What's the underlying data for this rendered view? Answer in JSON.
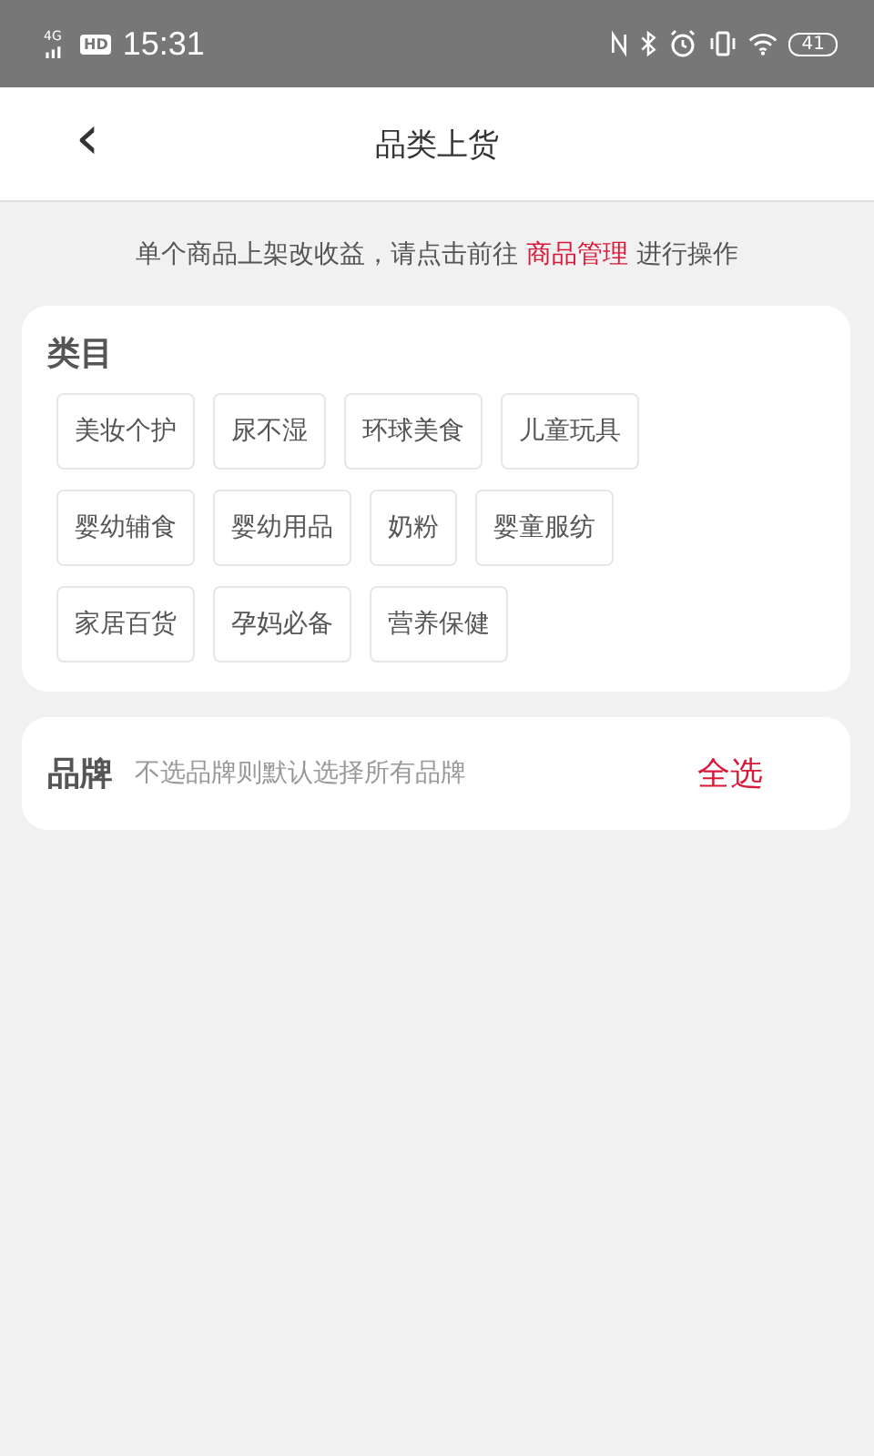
{
  "status_bar": {
    "network": "4G",
    "hd": "HD",
    "time": "15:31",
    "battery": "41"
  },
  "header": {
    "back": "‹",
    "title": "品类上货"
  },
  "notice": {
    "before": "单个商品上架改收益，请点击前往 ",
    "link": "商品管理",
    "after": " 进行操作"
  },
  "category": {
    "title": "类目",
    "chips": [
      "美妆个护",
      "尿不湿",
      "环球美食",
      "儿童玩具",
      "婴幼辅食",
      "婴幼用品",
      "奶粉",
      "婴童服纺",
      "家居百货",
      "孕妈必备",
      "营养保健"
    ]
  },
  "brand": {
    "title": "品牌",
    "placeholder": "不选品牌则默认选择所有品牌",
    "select_all": "全选"
  }
}
